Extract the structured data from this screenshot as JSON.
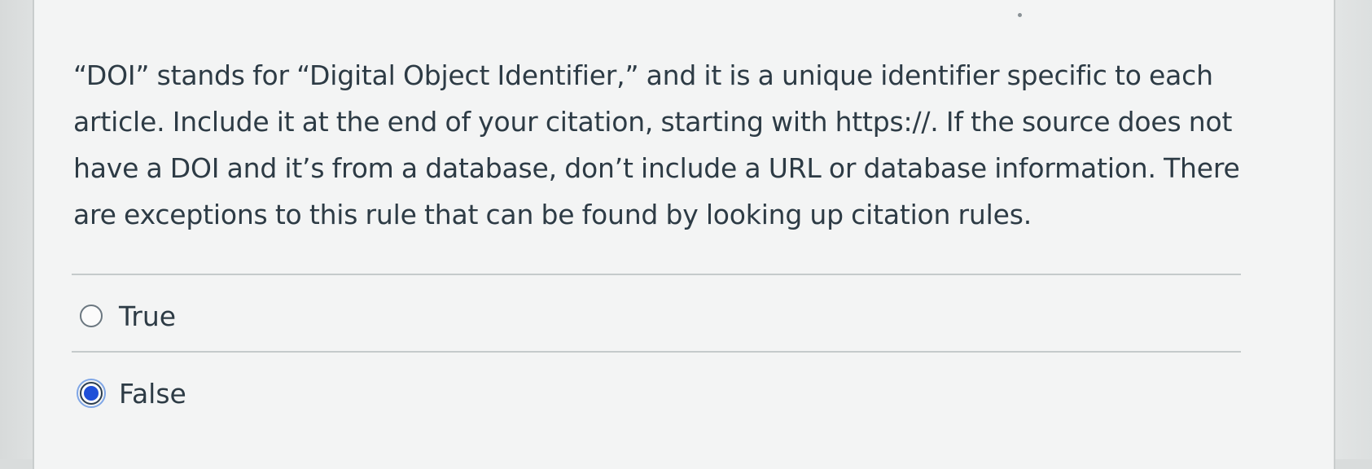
{
  "question": {
    "text": "“DOI” stands for “Digital Object Identifier,” and it is a unique identifier specific to each article. Include it at the end of your citation, starting with https://. If the source does not have a DOI and it’s from a database, don’t include a URL or database information. There are exceptions to this rule that can be found by looking up citation rules."
  },
  "answers": [
    {
      "label": "True",
      "selected": false
    },
    {
      "label": "False",
      "selected": true
    }
  ],
  "colors": {
    "text": "#2d3b45",
    "radio_selected": "#1f4fd8",
    "divider": "#c5cacb",
    "card_background": "#f3f4f4"
  },
  "icons": {
    "unselected": "radio-unchecked-icon",
    "selected": "radio-checked-icon"
  }
}
